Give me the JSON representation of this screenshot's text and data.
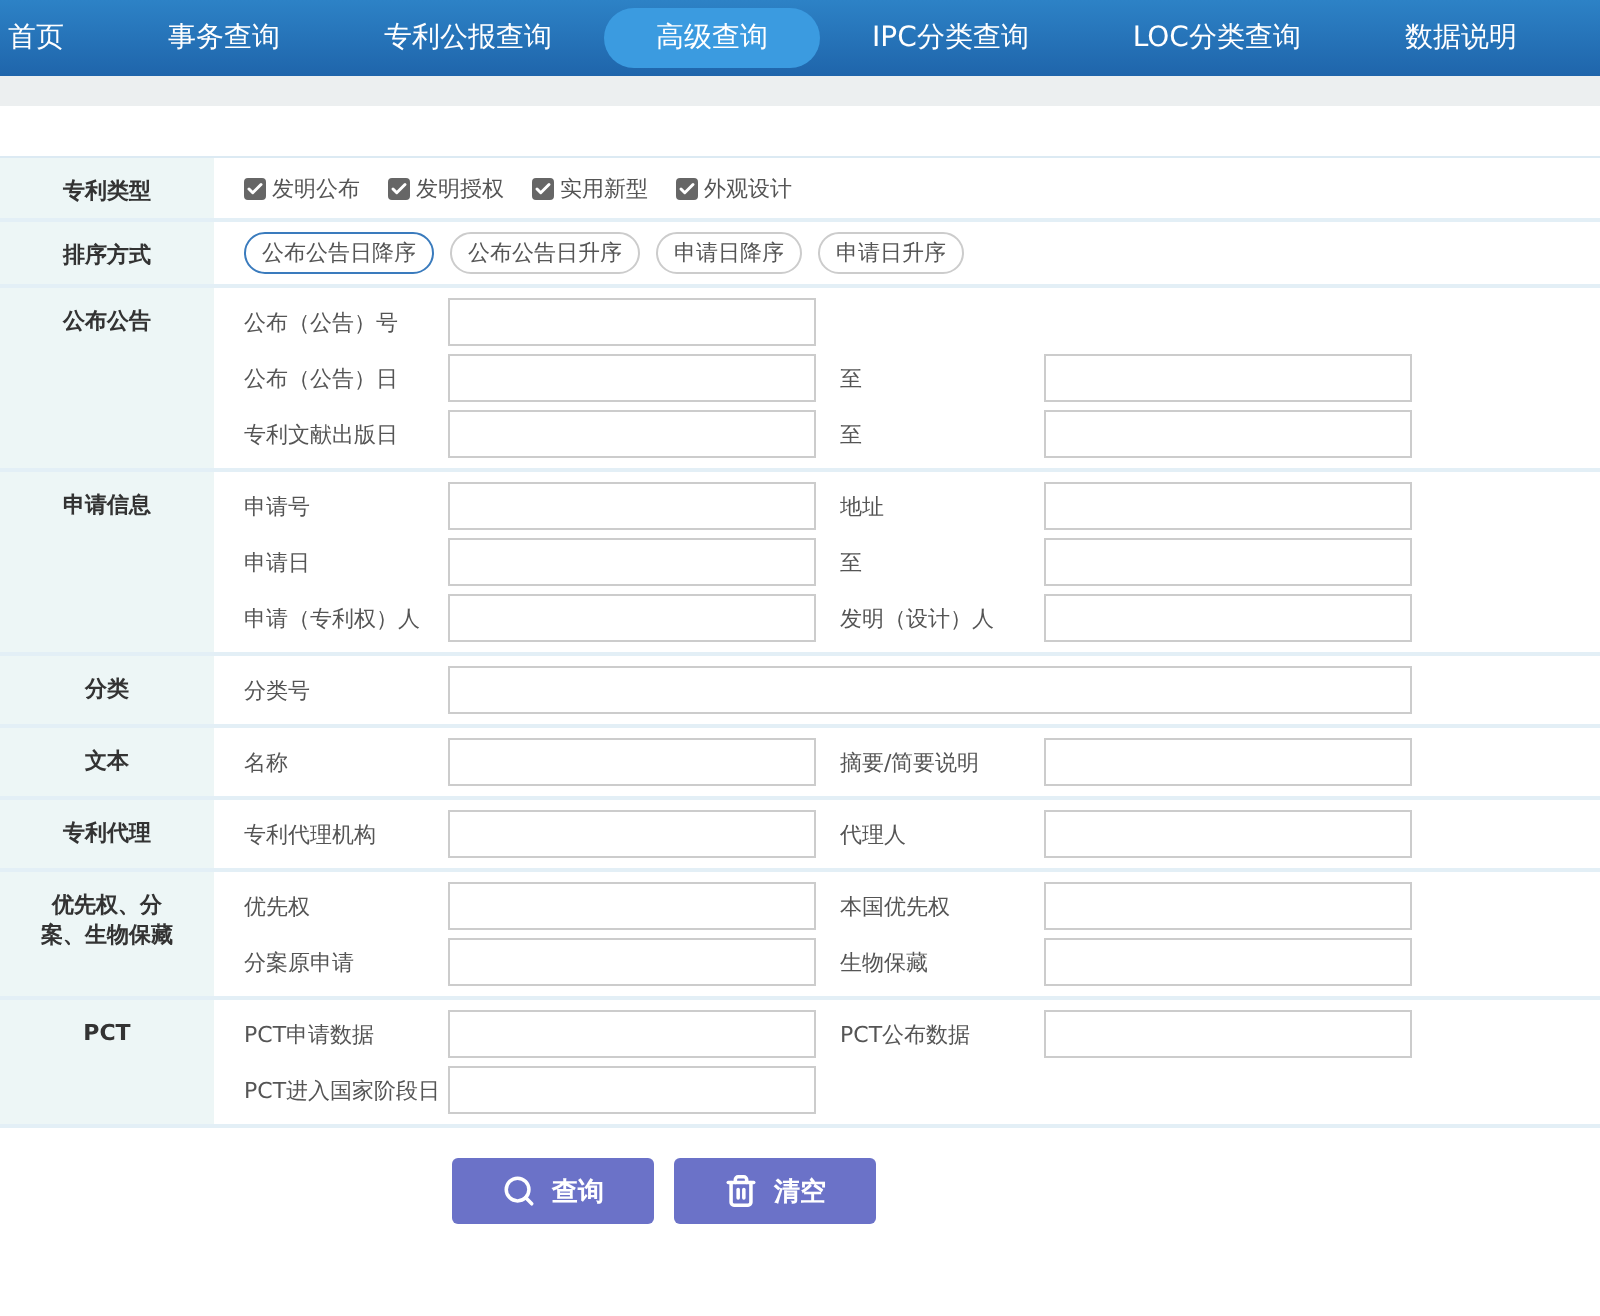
{
  "nav": [
    {
      "label": "首页",
      "selected": false
    },
    {
      "label": "事务查询",
      "selected": false
    },
    {
      "label": "专利公报查询",
      "selected": false
    },
    {
      "label": "高级查询",
      "selected": true
    },
    {
      "label": "IPC分类查询",
      "selected": false
    },
    {
      "label": "LOC分类查询",
      "selected": false
    },
    {
      "label": "数据说明",
      "selected": false
    }
  ],
  "sections": [
    {
      "label": "专利类型",
      "kind": "checks",
      "options": [
        {
          "label": "发明公布",
          "checked": true
        },
        {
          "label": "发明授权",
          "checked": true
        },
        {
          "label": "实用新型",
          "checked": true
        },
        {
          "label": "外观设计",
          "checked": true
        }
      ]
    },
    {
      "label": "排序方式",
      "kind": "sorts",
      "options": [
        {
          "label": "公布公告日降序",
          "selected": true
        },
        {
          "label": "公布公告日升序",
          "selected": false
        },
        {
          "label": "申请日降序",
          "selected": false
        },
        {
          "label": "申请日升序",
          "selected": false
        }
      ]
    },
    {
      "label": "公布公告",
      "kind": "fields",
      "rows": [
        {
          "kind": "pair",
          "fields": [
            "公布（公告）号"
          ]
        },
        {
          "kind": "pair",
          "fields": [
            "公布（公告）日",
            "至"
          ]
        },
        {
          "kind": "pair",
          "fields": [
            "专利文献出版日",
            "至"
          ]
        }
      ]
    },
    {
      "label": "申请信息",
      "kind": "fields",
      "rows": [
        {
          "kind": "pair",
          "fields": [
            "申请号",
            "地址"
          ]
        },
        {
          "kind": "pair",
          "fields": [
            "申请日",
            "至"
          ]
        },
        {
          "kind": "pair",
          "fields": [
            "申请（专利权）人",
            "发明（设计）人"
          ]
        }
      ]
    },
    {
      "label": "分类",
      "kind": "fields",
      "rows": [
        {
          "kind": "wide",
          "fields": [
            "分类号"
          ]
        }
      ]
    },
    {
      "label": "文本",
      "kind": "fields",
      "rows": [
        {
          "kind": "pair",
          "fields": [
            "名称",
            "摘要/简要说明"
          ]
        }
      ]
    },
    {
      "label": "专利代理",
      "kind": "fields",
      "rows": [
        {
          "kind": "pair",
          "fields": [
            "专利代理机构",
            "代理人"
          ]
        }
      ]
    },
    {
      "label": "优先权、分案、生物保藏",
      "kind": "fields",
      "rows": [
        {
          "kind": "pair",
          "fields": [
            "优先权",
            "本国优先权"
          ]
        },
        {
          "kind": "pair",
          "fields": [
            "分案原申请",
            "生物保藏"
          ]
        }
      ]
    },
    {
      "label": "PCT",
      "kind": "fields",
      "rows": [
        {
          "kind": "pair",
          "fields": [
            "PCT申请数据",
            "PCT公布数据"
          ]
        },
        {
          "kind": "pair",
          "fields": [
            "PCT进入国家阶段日"
          ]
        }
      ]
    }
  ],
  "buttons": [
    {
      "label": "查询",
      "kind": "search"
    },
    {
      "label": "清空",
      "kind": "clear"
    }
  ]
}
